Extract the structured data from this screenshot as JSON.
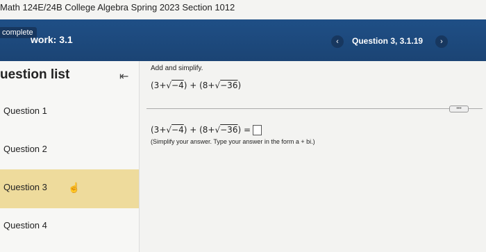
{
  "course": {
    "title": "Math 124E/24B College Algebra Spring 2023 Section 1012"
  },
  "homework": {
    "status_badge": "complete",
    "label": "work: 3.1",
    "question_nav": {
      "prev": "‹",
      "label": "Question 3, 3.1.19",
      "next": "›"
    }
  },
  "sidebar": {
    "title": "uestion list",
    "collapse_icon": "⇤",
    "items": [
      {
        "label": "Question 1"
      },
      {
        "label": "Question 2"
      },
      {
        "label": "Question 3"
      },
      {
        "label": "Question 4"
      }
    ]
  },
  "problem": {
    "instruction": "Add and simplify.",
    "expression_parts": [
      "(3+√",
      "−4",
      ") + (8+√",
      "−36",
      ")"
    ],
    "answer_parts": [
      "(3+√",
      "−4",
      ") + (8+√",
      "−36",
      ") ="
    ],
    "hint": "(Simplify your answer. Type your answer in the form a + bi.)",
    "more_label": "•••"
  }
}
